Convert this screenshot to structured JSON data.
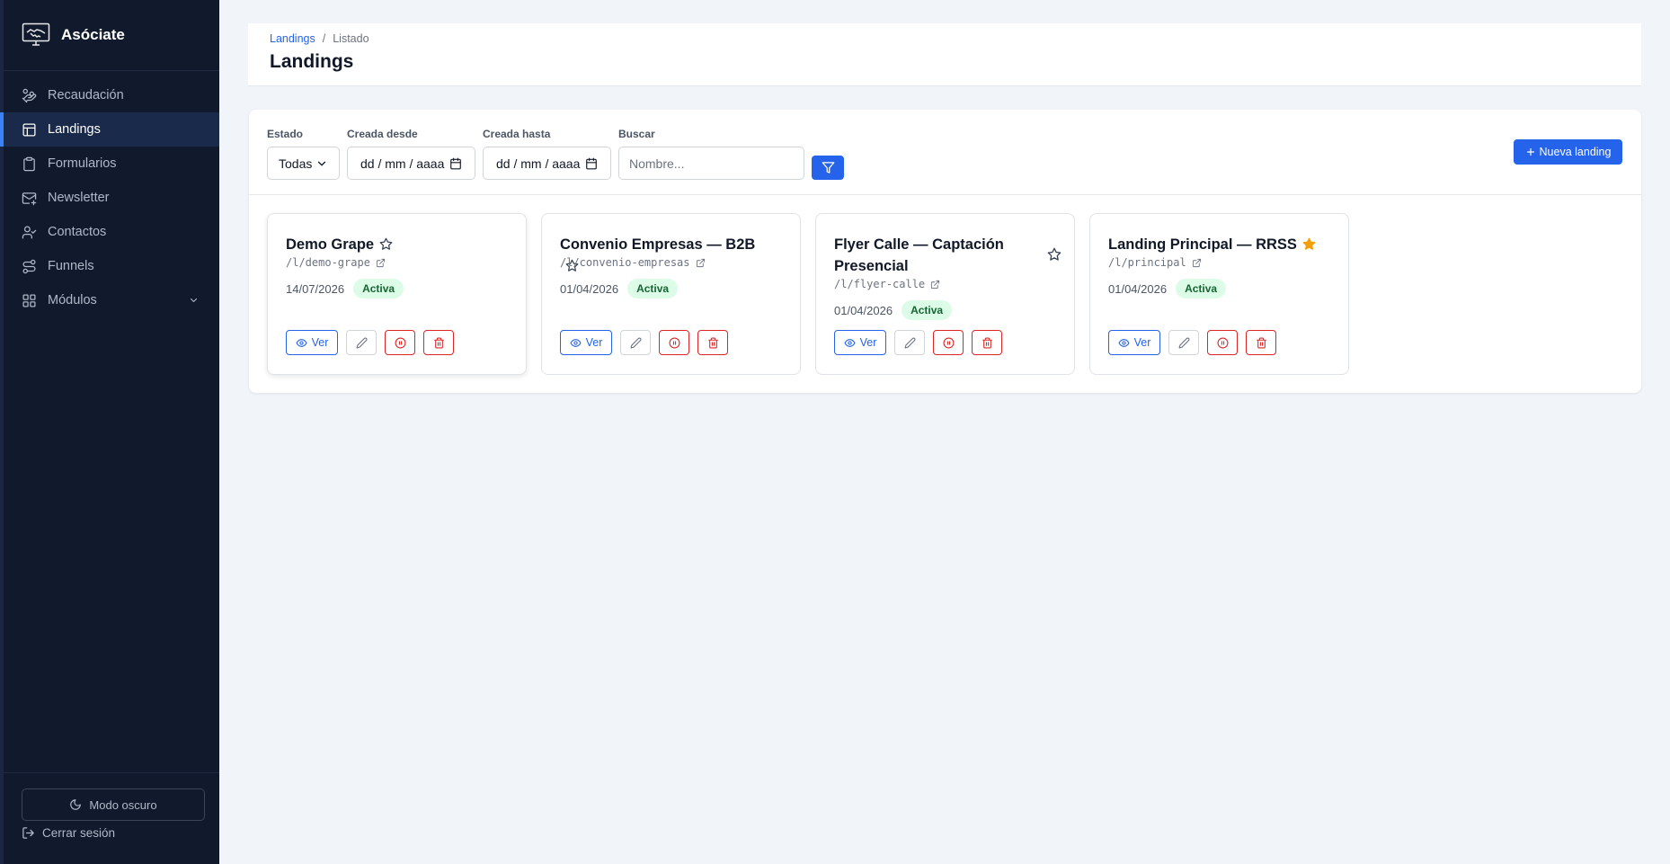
{
  "app": {
    "name": "Asóciate"
  },
  "sidebar": {
    "items": [
      {
        "label": "Recaudación",
        "icon": "hand-coins-icon"
      },
      {
        "label": "Landings",
        "icon": "layout-icon",
        "active": true
      },
      {
        "label": "Formularios",
        "icon": "clipboard-icon"
      },
      {
        "label": "Newsletter",
        "icon": "mail-icon"
      },
      {
        "label": "Contactos",
        "icon": "user-check-icon"
      },
      {
        "label": "Funnels",
        "icon": "route-icon"
      },
      {
        "label": "Módulos",
        "icon": "grid-icon",
        "expandable": true
      }
    ],
    "dark_mode_label": "Modo oscuro",
    "logout_label": "Cerrar sesión"
  },
  "header": {
    "breadcrumb": {
      "parent": "Landings",
      "separator": "/",
      "current": "Listado"
    },
    "title": "Landings"
  },
  "filters": {
    "estado": {
      "label": "Estado",
      "value": "Todas"
    },
    "desde": {
      "label": "Creada desde",
      "value": "dd / mm / aaaa"
    },
    "hasta": {
      "label": "Creada hasta",
      "value": "dd / mm / aaaa"
    },
    "buscar": {
      "label": "Buscar",
      "placeholder": "Nombre..."
    }
  },
  "new_button_label": "Nueva landing",
  "colors": {
    "accent": "#2563eb",
    "sidebar_bg": "#111a2c",
    "badge_bg": "#dcfce7",
    "badge_text": "#166534",
    "danger": "#dc2626",
    "star_active": "#f59e0b"
  },
  "cards": [
    {
      "title": "Demo Grape",
      "url": "/l/demo-grape",
      "date": "14/07/2026",
      "status": "Activa",
      "favorite": false,
      "view_label": "Ver"
    },
    {
      "title": "Convenio Empresas — B2B",
      "url": "/l/convenio-empresas",
      "date": "01/04/2026",
      "status": "Activa",
      "favorite": false,
      "view_label": "Ver"
    },
    {
      "title": "Flyer Calle — Captación Presencial",
      "url": "/l/flyer-calle",
      "date": "01/04/2026",
      "status": "Activa",
      "favorite": false,
      "view_label": "Ver"
    },
    {
      "title": "Landing Principal — RRSS",
      "url": "/l/principal",
      "date": "01/04/2026",
      "status": "Activa",
      "favorite": true,
      "view_label": "Ver"
    }
  ]
}
